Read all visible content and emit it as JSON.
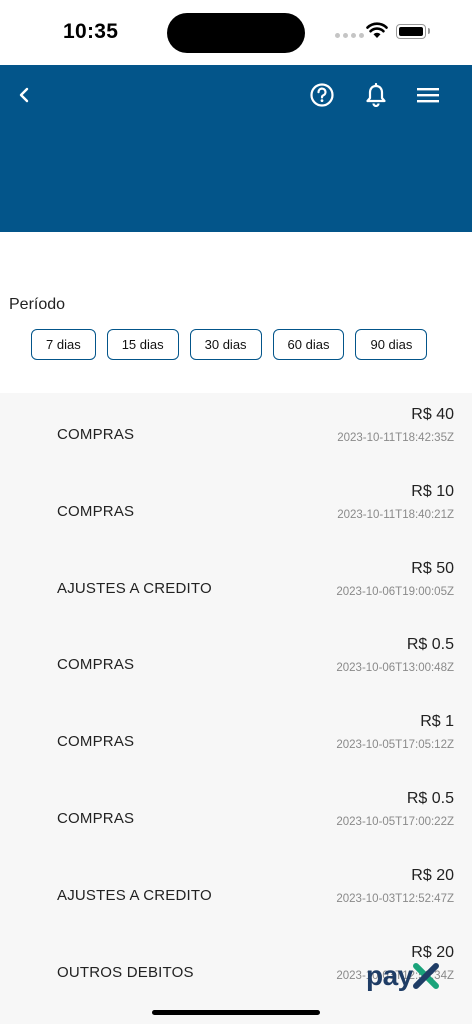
{
  "status_bar": {
    "time": "10:35"
  },
  "header": {
    "icons": {
      "back": "chevron-left-icon",
      "help": "question-circle-icon",
      "notifications": "bell-icon",
      "menu": "hamburger-menu-icon"
    }
  },
  "period": {
    "label": "Período",
    "options": [
      "7 dias",
      "15 dias",
      "30 dias",
      "60 dias",
      "90 dias"
    ]
  },
  "transactions": [
    {
      "description": "COMPRAS",
      "amount": "R$ 40",
      "date": "2023-10-11T18:42:35Z"
    },
    {
      "description": "COMPRAS",
      "amount": "R$ 10",
      "date": "2023-10-11T18:40:21Z"
    },
    {
      "description": "AJUSTES A CREDITO",
      "amount": "R$ 50",
      "date": "2023-10-06T19:00:05Z"
    },
    {
      "description": "COMPRAS",
      "amount": "R$ 0.5",
      "date": "2023-10-06T13:00:48Z"
    },
    {
      "description": "COMPRAS",
      "amount": "R$ 1",
      "date": "2023-10-05T17:05:12Z"
    },
    {
      "description": "COMPRAS",
      "amount": "R$ 0.5",
      "date": "2023-10-05T17:00:22Z"
    },
    {
      "description": "AJUSTES A CREDITO",
      "amount": "R$ 20",
      "date": "2023-10-03T12:52:47Z"
    },
    {
      "description": "OUTROS DEBITOS",
      "amount": "R$ 20",
      "date": "2023-10-03T12:52:34Z"
    }
  ],
  "logo": {
    "text": "pay",
    "mark": "X"
  },
  "colors": {
    "header": "#03558a",
    "list_background": "#f7f7f7",
    "chip_border": "#03558a",
    "logo_dark": "#1f3d66",
    "logo_accent": "#1aa37a"
  }
}
